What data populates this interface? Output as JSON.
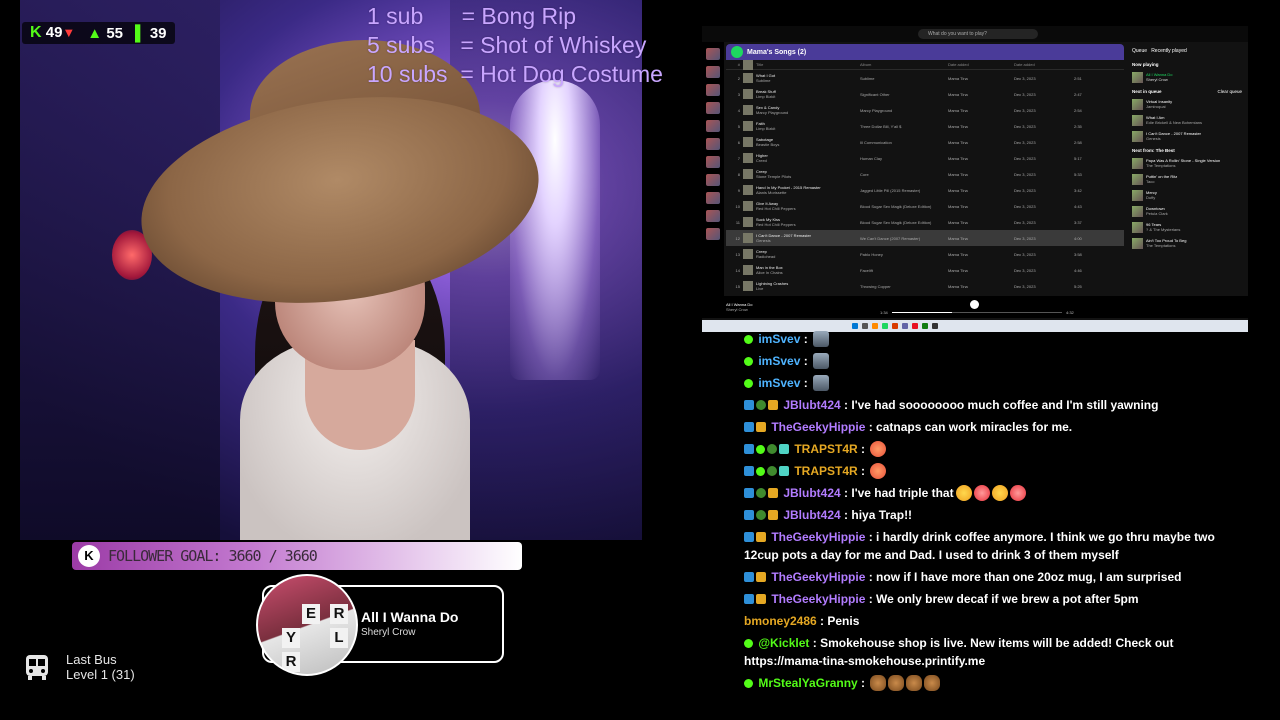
{
  "stream_stats": {
    "followers": "49",
    "viewers": "55",
    "chart": "39"
  },
  "sub_goals": [
    "1 sub      = Bong Rip",
    "5 subs    = Shot of Whiskey",
    "10 subs  = Hot Dog Costume"
  ],
  "follower_goal": {
    "text": "FOLLOWER GOAL: 3660 / 3660",
    "badge": "K"
  },
  "now_playing": {
    "title": "All I Wanna Do",
    "artist": "Sheryl Crow",
    "art_letters": [
      "E",
      "R",
      "Y",
      "L",
      "R"
    ]
  },
  "last_bus": {
    "line1": "Last Bus",
    "line2": "Level 1  (31)"
  },
  "desktop": {
    "search_placeholder": "What do you want to play?",
    "playlist": "Mama's Songs (2)",
    "columns": [
      "#",
      "Title",
      "Album",
      "Date added",
      "Date added"
    ],
    "tracks": [
      {
        "n": "2",
        "title": "What I Got",
        "artist": "Sublime",
        "album": "Sublime",
        "by": "Mama Tina",
        "date": "Dec 3, 2023",
        "dur": "2:51"
      },
      {
        "n": "3",
        "title": "Break Stuff",
        "artist": "Limp Bizkit",
        "album": "Significant Other",
        "by": "Mama Tina",
        "date": "Dec 3, 2023",
        "dur": "2:47"
      },
      {
        "n": "4",
        "title": "Sex & Candy",
        "artist": "Marcy Playground",
        "album": "Marcy Playground",
        "by": "Mama Tina",
        "date": "Dec 3, 2023",
        "dur": "2:54"
      },
      {
        "n": "5",
        "title": "Faith",
        "artist": "Limp Bizkit",
        "album": "Three Dollar Bill, Y'all $",
        "by": "Mama Tina",
        "date": "Dec 3, 2023",
        "dur": "2:35"
      },
      {
        "n": "6",
        "title": "Sabotage",
        "artist": "Beastie Boys",
        "album": "Ill Communication",
        "by": "Mama Tina",
        "date": "Dec 3, 2023",
        "dur": "2:58"
      },
      {
        "n": "7",
        "title": "Higher",
        "artist": "Creed",
        "album": "Human Clay",
        "by": "Mama Tina",
        "date": "Dec 3, 2023",
        "dur": "5:17"
      },
      {
        "n": "8",
        "title": "Creep",
        "artist": "Stone Temple Pilots",
        "album": "Core",
        "by": "Mama Tina",
        "date": "Dec 3, 2023",
        "dur": "5:33"
      },
      {
        "n": "9",
        "title": "Hand In My Pocket - 2015 Remaster",
        "artist": "Alanis Morissette",
        "album": "Jagged Little Pill (2015 Remaster)",
        "by": "Mama Tina",
        "date": "Dec 3, 2023",
        "dur": "3:42"
      },
      {
        "n": "10",
        "title": "Give It Away",
        "artist": "Red Hot Chili Peppers",
        "album": "Blood Sugar Sex Magik (Deluxe Edition)",
        "by": "Mama Tina",
        "date": "Dec 3, 2023",
        "dur": "4:43"
      },
      {
        "n": "11",
        "title": "Suck My Kiss",
        "artist": "Red Hot Chili Peppers",
        "album": "Blood Sugar Sex Magik (Deluxe Edition)",
        "by": "Mama Tina",
        "date": "Dec 3, 2023",
        "dur": "3:37"
      },
      {
        "n": "12",
        "title": "I Can't Dance - 2007 Remaster",
        "artist": "Genesis",
        "album": "We Can't Dance (2007 Remaster)",
        "by": "Mama Tina",
        "date": "Dec 3, 2023",
        "dur": "4:00"
      },
      {
        "n": "13",
        "title": "Creep",
        "artist": "Radiohead",
        "album": "Pablo Honey",
        "by": "Mama Tina",
        "date": "Dec 3, 2023",
        "dur": "3:58"
      },
      {
        "n": "14",
        "title": "Man in the Box",
        "artist": "Alice In Chains",
        "album": "Facelift",
        "by": "Mama Tina",
        "date": "Dec 3, 2023",
        "dur": "4:46"
      },
      {
        "n": "15",
        "title": "Lightning Crashes",
        "artist": "Live",
        "album": "Throwing Copper",
        "by": "Mama Tina",
        "date": "Dec 3, 2023",
        "dur": "5:25"
      }
    ],
    "queue": {
      "tabs": [
        "Queue",
        "Recently played"
      ],
      "now_playing_label": "Now playing",
      "current": {
        "title": "All I Wanna Do",
        "artist": "Sheryl Crow"
      },
      "next_label": "Next in queue",
      "clear": "Clear queue",
      "next": [
        {
          "title": "Virtual Insanity",
          "artist": "Jamiroquai"
        },
        {
          "title": "What I Am",
          "artist": "Edie Brickell & New Bohemians"
        },
        {
          "title": "I Can't Dance - 2007 Remaster",
          "artist": "Genesis"
        }
      ],
      "from_label": "Next from: The Best",
      "from": [
        {
          "title": "Papa Was A Rollin' Stone - Single Version",
          "artist": "The Temptations"
        },
        {
          "title": "Puttin' on the Ritz",
          "artist": "Taco"
        },
        {
          "title": "Mercy",
          "artist": "Duffy"
        },
        {
          "title": "Downtown",
          "artist": "Petula Clark"
        },
        {
          "title": "96 Tears",
          "artist": "? & The Mysterians"
        },
        {
          "title": "Ain't Too Proud To Beg",
          "artist": "The Temptations"
        }
      ]
    },
    "player": {
      "title": "All I Wanna Do",
      "artist": "Sheryl Crow",
      "elapsed": "1:34",
      "total": "4:32"
    }
  },
  "chat": [
    {
      "badges": [
        "check"
      ],
      "user": "imSvev",
      "color": "#4fb4ff",
      "text": "",
      "emotes": [
        "tree"
      ]
    },
    {
      "badges": [
        "check"
      ],
      "user": "imSvev",
      "color": "#4fb4ff",
      "text": "",
      "emotes": [
        "tree"
      ]
    },
    {
      "badges": [
        "check"
      ],
      "user": "imSvev",
      "color": "#4fb4ff",
      "text": "",
      "emotes": [
        "tree"
      ]
    },
    {
      "badges": [
        "arrow",
        "pot",
        "crown"
      ],
      "user": "JBlubt424",
      "color": "#b27cff",
      "text": "I've had soooooooo much coffee and I'm still yawning",
      "emotes": []
    },
    {
      "badges": [
        "arrow",
        "crown"
      ],
      "user": "TheGeekyHippie",
      "color": "#b27cff",
      "text": "catnaps can work miracles for me.",
      "emotes": []
    },
    {
      "badges": [
        "arrow",
        "check",
        "pot",
        "gift"
      ],
      "user": "TRAPST4R",
      "color": "#e5a823",
      "text": "",
      "emotes": [
        "peach"
      ]
    },
    {
      "badges": [
        "arrow",
        "check",
        "pot",
        "gift"
      ],
      "user": "TRAPST4R",
      "color": "#e5a823",
      "text": "",
      "emotes": [
        "peach"
      ]
    },
    {
      "badges": [
        "arrow",
        "pot",
        "crown"
      ],
      "user": "JBlubt424",
      "color": "#b27cff",
      "text": "I've had triple that",
      "emotes": [
        "laugh",
        "heart",
        "laugh",
        "heart"
      ]
    },
    {
      "badges": [
        "arrow",
        "pot",
        "crown"
      ],
      "user": "JBlubt424",
      "color": "#b27cff",
      "text": "hiya Trap!!",
      "emotes": []
    },
    {
      "badges": [
        "arrow",
        "crown"
      ],
      "user": "TheGeekyHippie",
      "color": "#b27cff",
      "text": "i hardly drink coffee anymore. I think we go thru maybe two 12cup pots a day for me and Dad. I used to drink 3 of them myself",
      "emotes": []
    },
    {
      "badges": [
        "arrow",
        "crown"
      ],
      "user": "TheGeekyHippie",
      "color": "#b27cff",
      "text": "now if I have more than one 20oz mug, I am surprised",
      "emotes": []
    },
    {
      "badges": [
        "arrow",
        "crown"
      ],
      "user": "TheGeekyHippie",
      "color": "#b27cff",
      "text": "We only brew decaf if we brew a pot after 5pm",
      "emotes": []
    },
    {
      "badges": [],
      "user": "bmoney2486",
      "color": "#e5a823",
      "text": "Penis",
      "emotes": []
    },
    {
      "badges": [
        "check"
      ],
      "user": "@Kicklet",
      "color": "#53fc18",
      "text": "Smokehouse shop is live. New items will be added! Check out https://mama-tina-smokehouse.printify.me",
      "emotes": []
    },
    {
      "badges": [
        "check"
      ],
      "user": "MrStealYaGranny",
      "color": "#53fc18",
      "text": "",
      "emotes": [
        "cookie",
        "cookie",
        "cookie",
        "cookie"
      ]
    }
  ]
}
